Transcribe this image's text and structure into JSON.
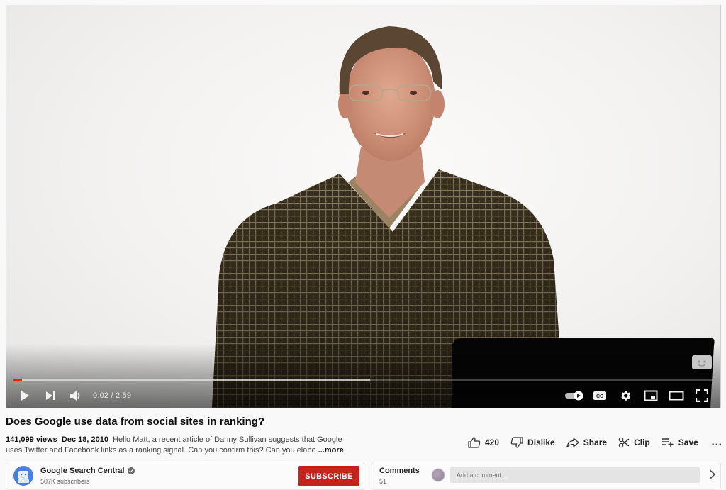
{
  "player": {
    "progress_played_fraction": 0.012,
    "progress_buffered_fraction": 0.51,
    "time_current": "0:02",
    "time_total": "2:59",
    "time_display": "0:02 / 2:59",
    "controls": {
      "play": "play-icon",
      "next": "next-icon",
      "volume": "volume-icon",
      "autoplay": "autoplay-toggle-icon",
      "captions": "cc-icon",
      "settings": "gear-icon",
      "miniplayer": "miniplayer-icon",
      "theater": "theater-icon",
      "fullscreen": "fullscreen-icon"
    }
  },
  "video": {
    "title": "Does Google use data from social sites in ranking?",
    "views": "141,099 views",
    "date": "Dec 18, 2010",
    "description": "Hello Matt, a recent article of Danny Sullivan suggests that Google uses Twitter and Facebook links as a ranking signal. Can you confirm this? Can you elabo",
    "more_label": "...more"
  },
  "actions": {
    "like_count": "420",
    "dislike_label": "Dislike",
    "share_label": "Share",
    "clip_label": "Clip",
    "save_label": "Save",
    "more_label": "…"
  },
  "channel": {
    "name": "Google Search Central",
    "subscribers": "507K subscribers",
    "verified": true,
    "subscribe_label": "SUBSCRIBE"
  },
  "comments": {
    "label": "Comments",
    "count": "51",
    "placeholder": "Add a comment..."
  },
  "colors": {
    "progress_played": "#e62117",
    "subscribe_button": "#c4241b",
    "page_background": "#f9f9f9"
  }
}
